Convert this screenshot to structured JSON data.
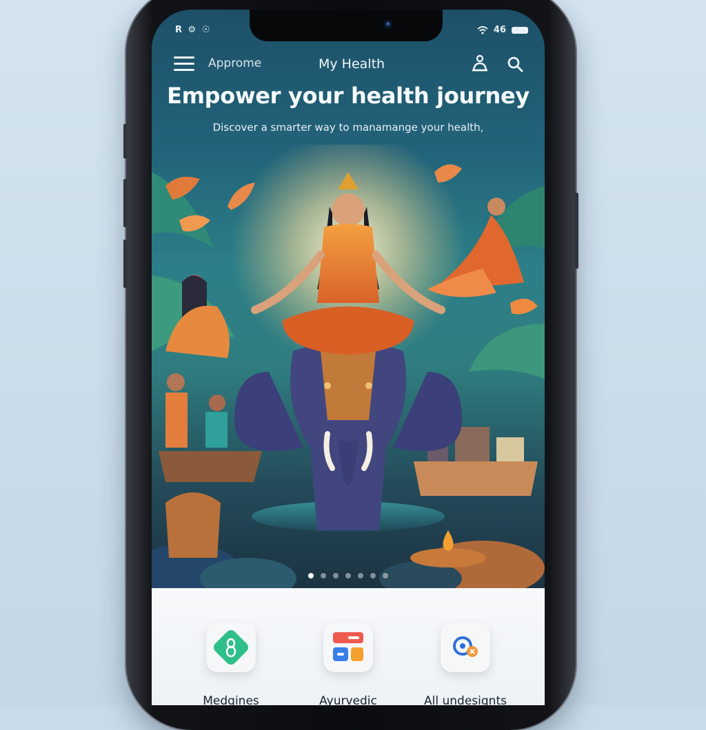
{
  "status_bar": {
    "left_icons": "R ⚙ ☉",
    "right_text": "46"
  },
  "appbar": {
    "brand": "Approme",
    "title": "My Health"
  },
  "hero": {
    "headline": "Empower your health journey",
    "subheadline": "Discover a smarter way to manamange your health,",
    "carousel_count": 7,
    "carousel_active_index": 0
  },
  "categories": [
    {
      "label": "Medgines",
      "icon": "medicine-icon"
    },
    {
      "label": "Ayurvedic",
      "icon": "ayurvedic-icon"
    },
    {
      "label": "All undesignts",
      "icon": "all-categories-icon"
    }
  ],
  "colors": {
    "hero_top": "#1d5068",
    "saffron": "#e07a2e",
    "elephant": "#3b3f7a",
    "sheet": "#f7f9fb",
    "accent_green": "#2fbf8a"
  }
}
